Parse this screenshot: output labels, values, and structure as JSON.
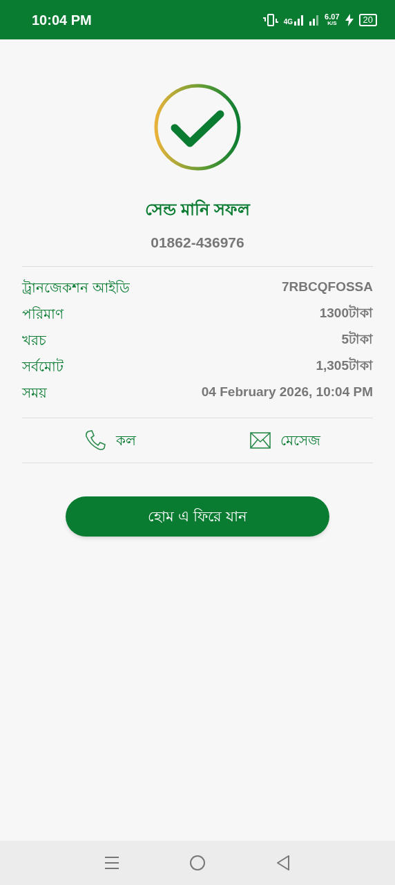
{
  "status_bar": {
    "time": "10:04 PM",
    "network": "4G",
    "speed": "6.07",
    "speed_unit": "K/S",
    "battery": "20",
    "charging": true
  },
  "result": {
    "title": "সেন্ড মানি সফল",
    "number": "01862-436976"
  },
  "details": [
    {
      "label": "ট্রানজেকশন আইডি",
      "value": "7RBCQFOSSA"
    },
    {
      "label": "পরিমাণ",
      "value": "1300টাকা"
    },
    {
      "label": "খরচ",
      "value": "5টাকা"
    },
    {
      "label": "সর্বমোট",
      "value": "1,305টাকা"
    },
    {
      "label": "সময়",
      "value": "04 February 2026, 10:04 PM"
    }
  ],
  "actions": [
    {
      "kind": "call",
      "label": "কল"
    },
    {
      "kind": "message",
      "label": "মেসেজ"
    }
  ],
  "home_button": "হোম এ ফিরে যান"
}
